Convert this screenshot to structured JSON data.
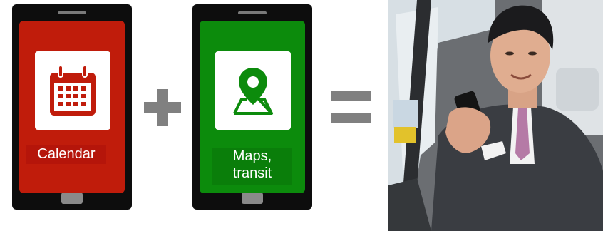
{
  "phones": [
    {
      "app": "Calendar",
      "label": "Calendar",
      "screen_color": "#c01c0b",
      "label_bg": "#b5150a",
      "icon": "calendar-icon"
    },
    {
      "app": "Maps",
      "label_line1": "Maps,",
      "label_line2": "transit",
      "screen_color": "#0c8b0c",
      "label_bg": "#0a7e0a",
      "icon": "map-pin-icon"
    }
  ],
  "operators": {
    "plus": "plus-icon",
    "equals": "equals-icon",
    "color": "#808080"
  },
  "photo": {
    "subject": "man-using-smartphone-in-taxi"
  }
}
